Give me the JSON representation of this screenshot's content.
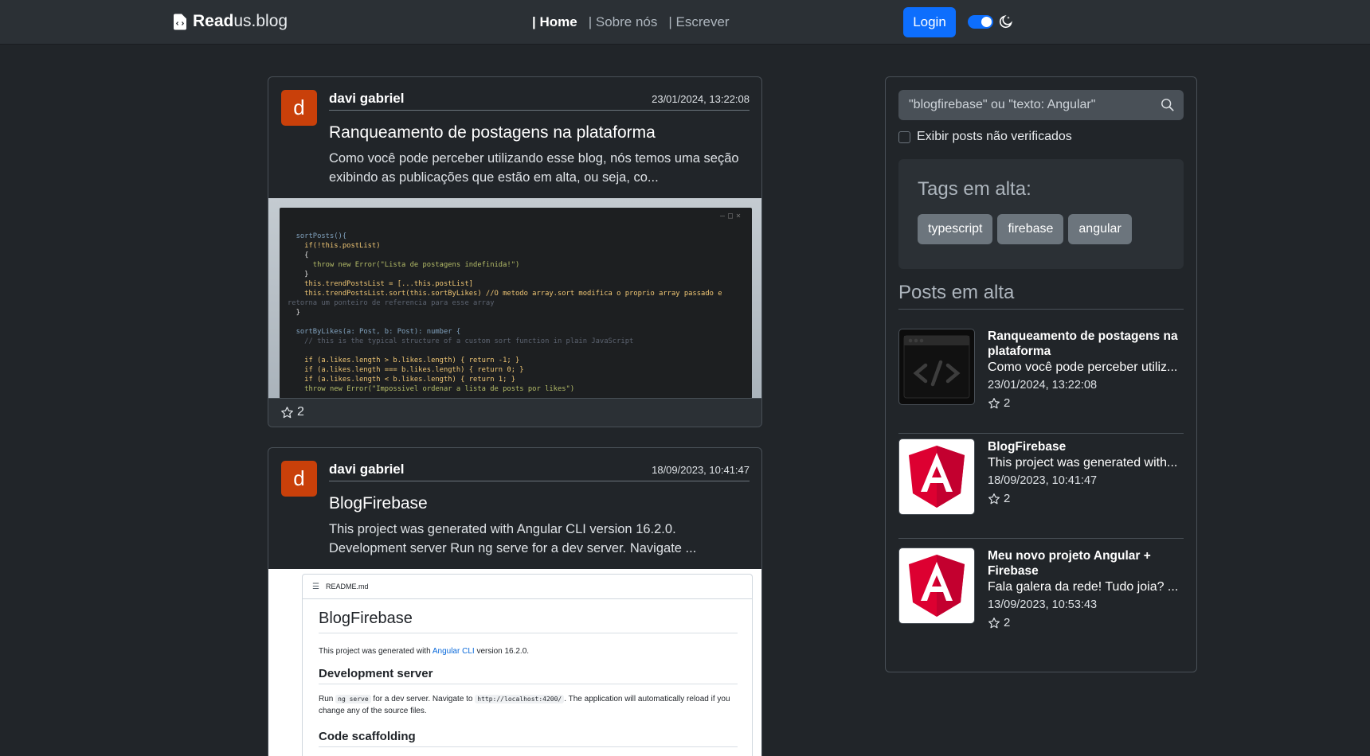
{
  "navbar": {
    "brand_bold": "Read",
    "brand_light": "us.blog",
    "links": [
      {
        "label": "| Home",
        "active": true
      },
      {
        "label": "| Sobre nós",
        "active": false
      },
      {
        "label": "| Escrever",
        "active": false
      }
    ],
    "login_label": "Login"
  },
  "posts": [
    {
      "avatar_letter": "d",
      "author": "davi gabriel",
      "date": "23/01/2024, 13:22:08",
      "title": "Ranqueamento de postagens na plataforma",
      "excerpt": "Como você pode perceber utilizando esse blog, nós temos uma seção exibindo as publicações que estão em alta, ou seja, co...",
      "stars": "2",
      "code_lines": [
        "  sortPosts(){",
        "    if(!this.postList)",
        "    {",
        "      throw new Error(\"Lista de postagens indefinida!\")",
        "    }",
        "    this.trendPostsList = [...this.postList]",
        "    this.trendPostsList.sort(this.sortByLikes) //O metodo array.sort modifica o proprio array passado e",
        "retorna um ponteiro de referencia para esse array",
        "  }",
        "",
        "  sortByLikes(a: Post, b: Post): number {",
        "    // this is the typical structure of a custom sort function in plain JavaScript",
        "",
        "    if (a.likes.length > b.likes.length) { return -1; }",
        "    if (a.likes.length === b.likes.length) { return 0; }",
        "    if (a.likes.length < b.likes.length) { return 1; }",
        "    throw new Error(\"Impossivel ordenar a lista de posts por likes\")"
      ]
    },
    {
      "avatar_letter": "d",
      "author": "davi gabriel",
      "date": "18/09/2023, 10:41:47",
      "title": "BlogFirebase",
      "excerpt": "This project was generated with Angular CLI version 16.2.0. Development server Run ng serve for a dev server. Navigate ...",
      "readme": {
        "file": "README.md",
        "h1": "BlogFirebase",
        "p1_before": "This project was generated with ",
        "p1_link": "Angular CLI",
        "p1_after": " version 16.2.0.",
        "h2_dev": "Development server",
        "p2_run": "Run ",
        "p2_cmd": "ng serve",
        "p2_mid": " for a dev server. Navigate to ",
        "p2_url": "http://localhost:4200/",
        "p2_after": ". The application will automatically reload if you change any of the source files.",
        "h2_scaffold": "Code scaffolding"
      }
    }
  ],
  "sidebar": {
    "search_placeholder": "\"blogfirebase\" ou \"texto: Angular\"",
    "show_unverified_label": "Exibir posts não verificados",
    "tags_title": "Tags em alta:",
    "tags": [
      "typescript",
      "firebase",
      "angular"
    ],
    "trending_title": "Posts em alta",
    "trending": [
      {
        "title": "Ranqueamento de postagens na plataforma",
        "excerpt": "Como você pode perceber utiliz...",
        "date": "23/01/2024, 13:22:08",
        "stars": "2",
        "thumb": "code-icon"
      },
      {
        "title": "BlogFirebase",
        "excerpt": "This project was generated with...",
        "date": "18/09/2023, 10:41:47",
        "stars": "2",
        "thumb": "angular-logo"
      },
      {
        "title": "Meu novo projeto Angular + Firebase",
        "excerpt": "Fala galera da rede! Tudo joia? ...",
        "date": "13/09/2023, 10:53:43",
        "stars": "2",
        "thumb": "angular-logo"
      }
    ]
  },
  "colors": {
    "background": "#212529",
    "navbar": "#2b3035",
    "primary": "#0d6efd",
    "avatar": "#c9400a",
    "tag": "#6c757d",
    "angular_red": "#dd0031"
  }
}
